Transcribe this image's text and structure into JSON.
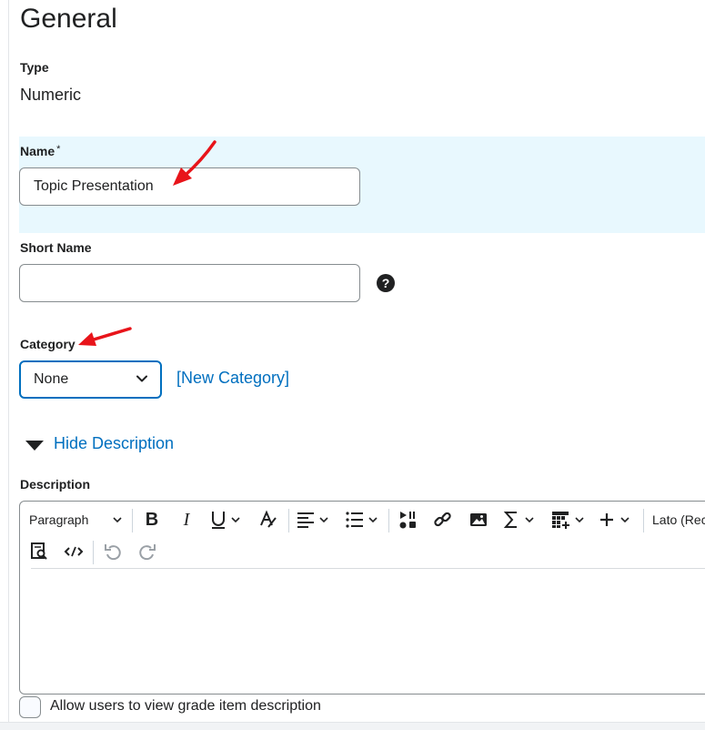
{
  "section_title": "General",
  "type": {
    "label": "Type",
    "value": "Numeric"
  },
  "name": {
    "label": "Name",
    "required_marker": "*",
    "value": "Topic Presentation"
  },
  "short_name": {
    "label": "Short Name",
    "value": "",
    "help_glyph": "?"
  },
  "category": {
    "label": "Category",
    "selected": "None",
    "new_link": "[New Category]"
  },
  "description_toggle": "Hide Description",
  "description": {
    "label": "Description",
    "toolbar": {
      "block_format": "Paragraph",
      "font_family": "Lato (Recommended)",
      "icons": [
        "bold-icon",
        "italic-icon",
        "underline-icon",
        "strikethrough-icon",
        "align-icon",
        "list-icon",
        "insert-stuff-icon",
        "link-icon",
        "image-icon",
        "equation-icon",
        "table-icon",
        "insert-more-icon",
        "preview-icon",
        "source-code-icon",
        "undo-icon",
        "redo-icon"
      ]
    },
    "value": ""
  },
  "allow_view_checkbox": {
    "label": "Allow users to view grade item description",
    "checked": false
  },
  "colors": {
    "accent": "#006fbf",
    "highlight": "#e8f8fe",
    "annotation_arrow": "#e8141a"
  }
}
